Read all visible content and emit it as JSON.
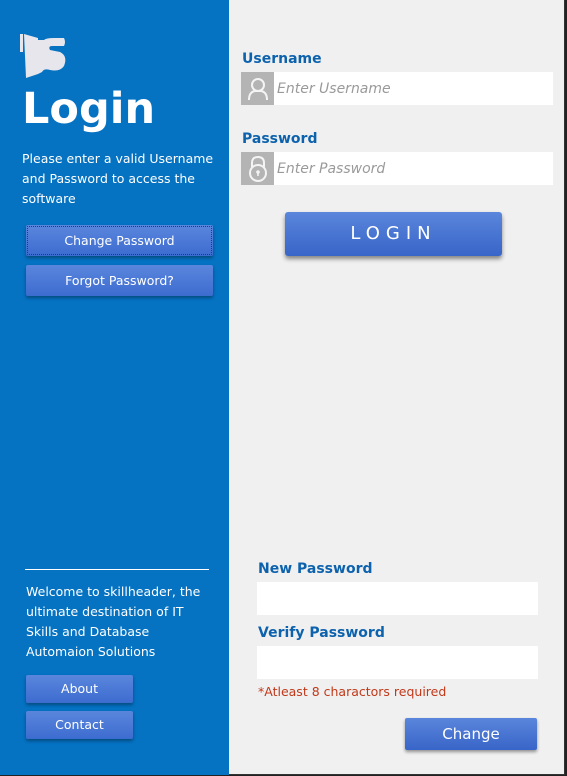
{
  "sidebar": {
    "logo": "skillheader-logo",
    "title": "Login",
    "intro": "Please enter a valid Username and Password to access the software",
    "buttons": {
      "change_password": "Change Password",
      "forgot_password": "Forgot Password?"
    },
    "welcome": "Welcome to skillheader, the ultimate destination of IT Skills and Database Automaion Solutions",
    "about": "About",
    "contact": "Contact"
  },
  "login_form": {
    "username_label": "Username",
    "username_placeholder": "Enter Username",
    "username_value": "",
    "username_icon": "user-icon",
    "password_label": "Password",
    "password_placeholder": "Enter Password",
    "password_value": "",
    "password_icon": "lock-icon",
    "login_button": "LOGIN"
  },
  "change_form": {
    "new_password_label": "New Password",
    "new_password_value": "",
    "verify_password_label": "Verify Password",
    "verify_password_value": "",
    "hint": "*Atleast 8 charactors required",
    "change_button": "Change"
  },
  "colors": {
    "sidebar_bg": "#0572c2",
    "button_blue": "#4a78d6",
    "label_blue": "#0d62ad",
    "hint_red": "#c0391a",
    "panel_bg": "#f0f0f0"
  }
}
